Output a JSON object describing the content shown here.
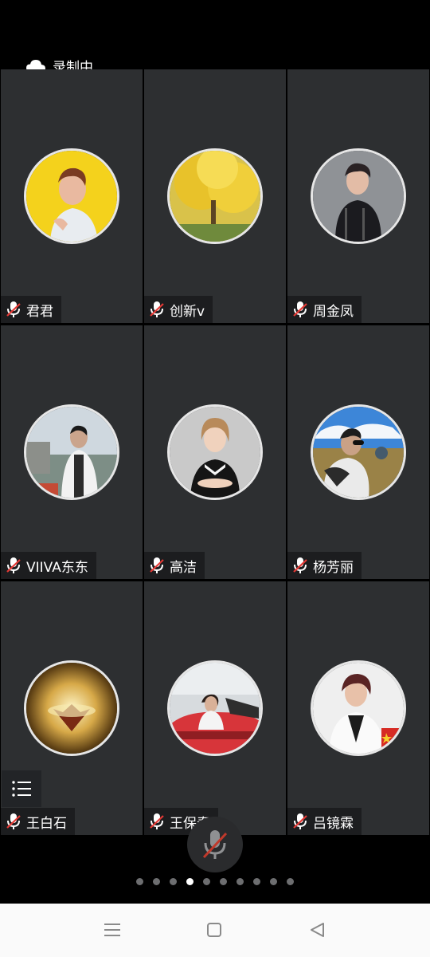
{
  "status": {
    "recording_label": "录制中"
  },
  "participants": [
    {
      "name": "君君",
      "avatar": "woman-yellow-bg"
    },
    {
      "name": "创新v",
      "avatar": "golden-ginkgo-tree"
    },
    {
      "name": "周金凤",
      "avatar": "woman-black-outfit"
    },
    {
      "name": "VIIVA东东",
      "avatar": "young-man-river"
    },
    {
      "name": "高洁",
      "avatar": "woman-gray-bg"
    },
    {
      "name": "杨芳丽",
      "avatar": "woman-sunglasses-landscape"
    },
    {
      "name": "王白石",
      "avatar": "glowing-lamp"
    },
    {
      "name": "王保春",
      "avatar": "woman-red-car"
    },
    {
      "name": "吕镜霖",
      "avatar": "woman-white-jacket-flag"
    }
  ],
  "pagination": {
    "total": 10,
    "current": 4
  },
  "icons": {
    "recording": "cloud-icon",
    "muted": "mic-off-icon",
    "menu": "list-icon",
    "mic": "mic-off-icon",
    "nav_recent": "menu-icon",
    "nav_home": "square-icon",
    "nav_back": "back-triangle-icon"
  }
}
